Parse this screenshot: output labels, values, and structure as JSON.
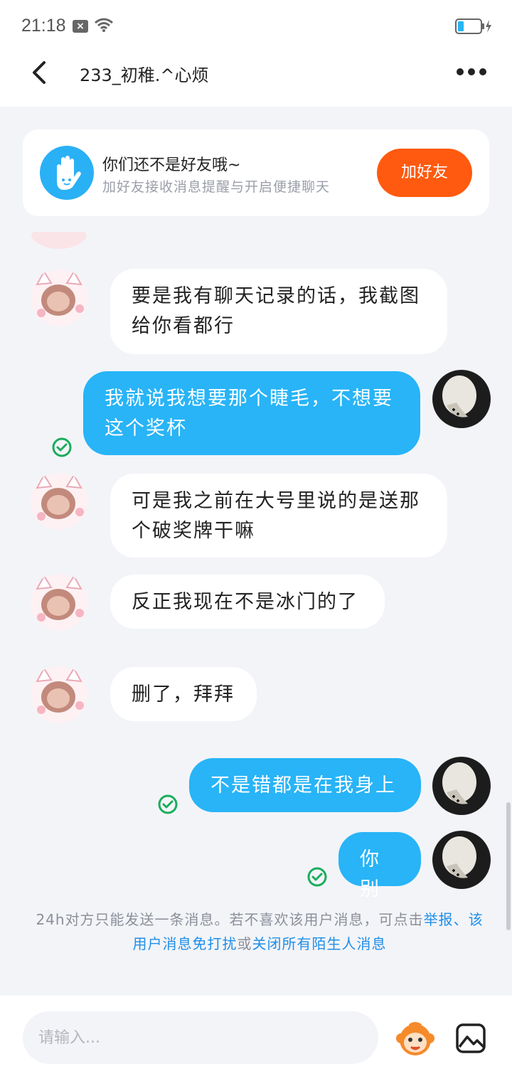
{
  "status_bar": {
    "time": "21:18",
    "notification_icon": "x-box-icon",
    "wifi_icon": "wifi-icon",
    "battery_icon": "battery-charging-icon"
  },
  "header": {
    "title": "233_初稚.^心烦",
    "back_icon": "chevron-left-icon",
    "more_icon": "more-dots-icon"
  },
  "friend_banner": {
    "title": "你们还不是好友哦~",
    "subtitle": "加好友接收消息提醒与开启便捷聊天",
    "button_label": "加好友",
    "icon": "hand-wave-icon"
  },
  "messages": [
    {
      "direction": "in",
      "text": "要是我有聊天记录的话，我截图给你看都行",
      "line1": "要是我有聊天记录的话，我截图",
      "line2": "给你看都行"
    },
    {
      "direction": "out",
      "text": "我就说我想要那个睫毛，不想要这个奖杯",
      "line1": "我就说我想要那个睫毛，不想要",
      "line2": "这个奖杯",
      "read": true
    },
    {
      "direction": "in",
      "text": "可是我之前在大号里说的是送那个破奖牌干嘛",
      "line1": "可是我之前在大号里说的是送那",
      "line2": "个破奖牌干嘛"
    },
    {
      "direction": "in",
      "text": "反正我现在不是冰门的了"
    },
    {
      "direction": "in",
      "text": "删了，拜拜"
    },
    {
      "direction": "out",
      "text": "不是错都是在我身上",
      "read": true
    },
    {
      "direction": "out",
      "text": "你别",
      "read": true
    }
  ],
  "notice": {
    "text_before": "24h对方只能发送一条消息。若不喜欢该用户消息，可点击",
    "link_report": "举报",
    "separator": "、",
    "link_mute": "该用户消息免打扰",
    "or": "或",
    "link_close": "关闭所有陌生人消息"
  },
  "input": {
    "placeholder": "请输入...",
    "emoji_icon": "emoji-monkey-icon",
    "image_icon": "image-icon"
  },
  "colors": {
    "accent_blue": "#28b4f7",
    "add_button": "#ff5a0f",
    "link": "#1e8ee8",
    "background": "#f3f4f8"
  }
}
